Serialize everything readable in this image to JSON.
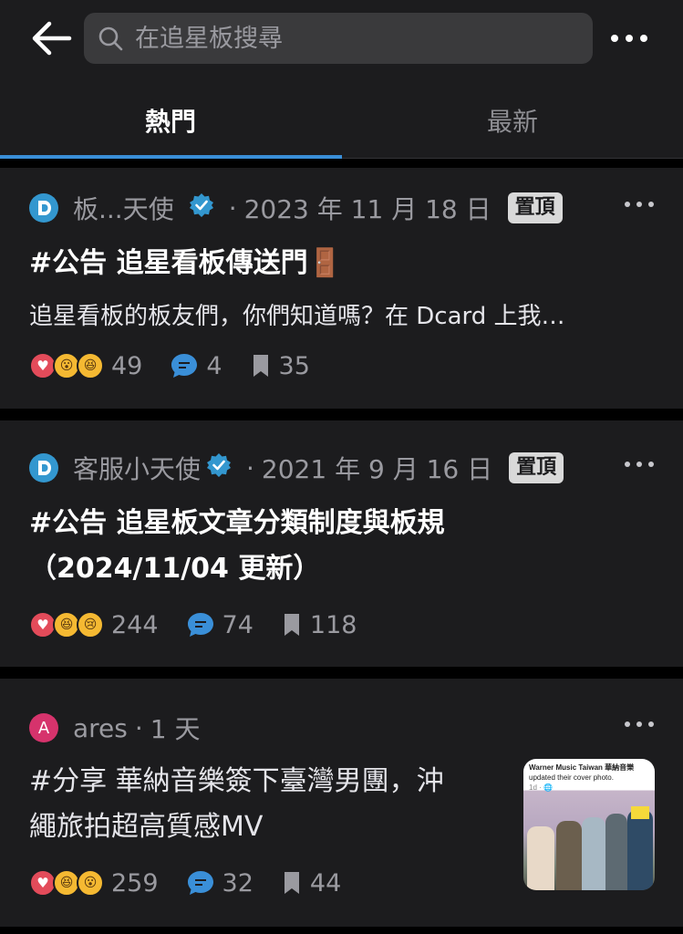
{
  "search": {
    "placeholder": "在追星板搜尋"
  },
  "tabs": [
    {
      "label": "熱門",
      "active": true
    },
    {
      "label": "最新",
      "active": false
    }
  ],
  "colors": {
    "accent": "#3a8fd8",
    "card_bg": "#1c1c1e",
    "pin_bg": "#d9d9d9"
  },
  "posts": [
    {
      "author": "板...天使",
      "verified": true,
      "date": "2023 年 11 月 18 日",
      "pin_label": "置頂",
      "title": "#公告 追星看板傳送門🚪",
      "excerpt": "追星看板的板友們，你們知道嗎？在 Dcard 上我…",
      "reactions": [
        "heart",
        "wow",
        "laugh"
      ],
      "likes": "49",
      "comments": "4",
      "saves": "35"
    },
    {
      "author": "客服小天使",
      "verified": true,
      "date": "2021 年 9 月 16 日",
      "pin_label": "置頂",
      "title_line1": "#公告 追星板文章分類制度與板規",
      "title_line2": "（2024/11/04 更新）",
      "reactions": [
        "heart",
        "laugh",
        "cry"
      ],
      "likes": "244",
      "comments": "74",
      "saves": "118"
    },
    {
      "avatar_letter": "A",
      "author": "ares",
      "time": "1 天",
      "title_line1": "#分享 華納音樂簽下臺灣男團，沖",
      "title_line2": "繩旅拍超高質感MV",
      "reactions": [
        "heart",
        "laugh",
        "wow"
      ],
      "likes": "259",
      "comments": "32",
      "saves": "44",
      "thumbnail": {
        "header_line1": "Warner Music Taiwan 華納音樂",
        "header_line2": "updated their cover photo.",
        "header_line3": "1d · 🌐"
      }
    }
  ]
}
